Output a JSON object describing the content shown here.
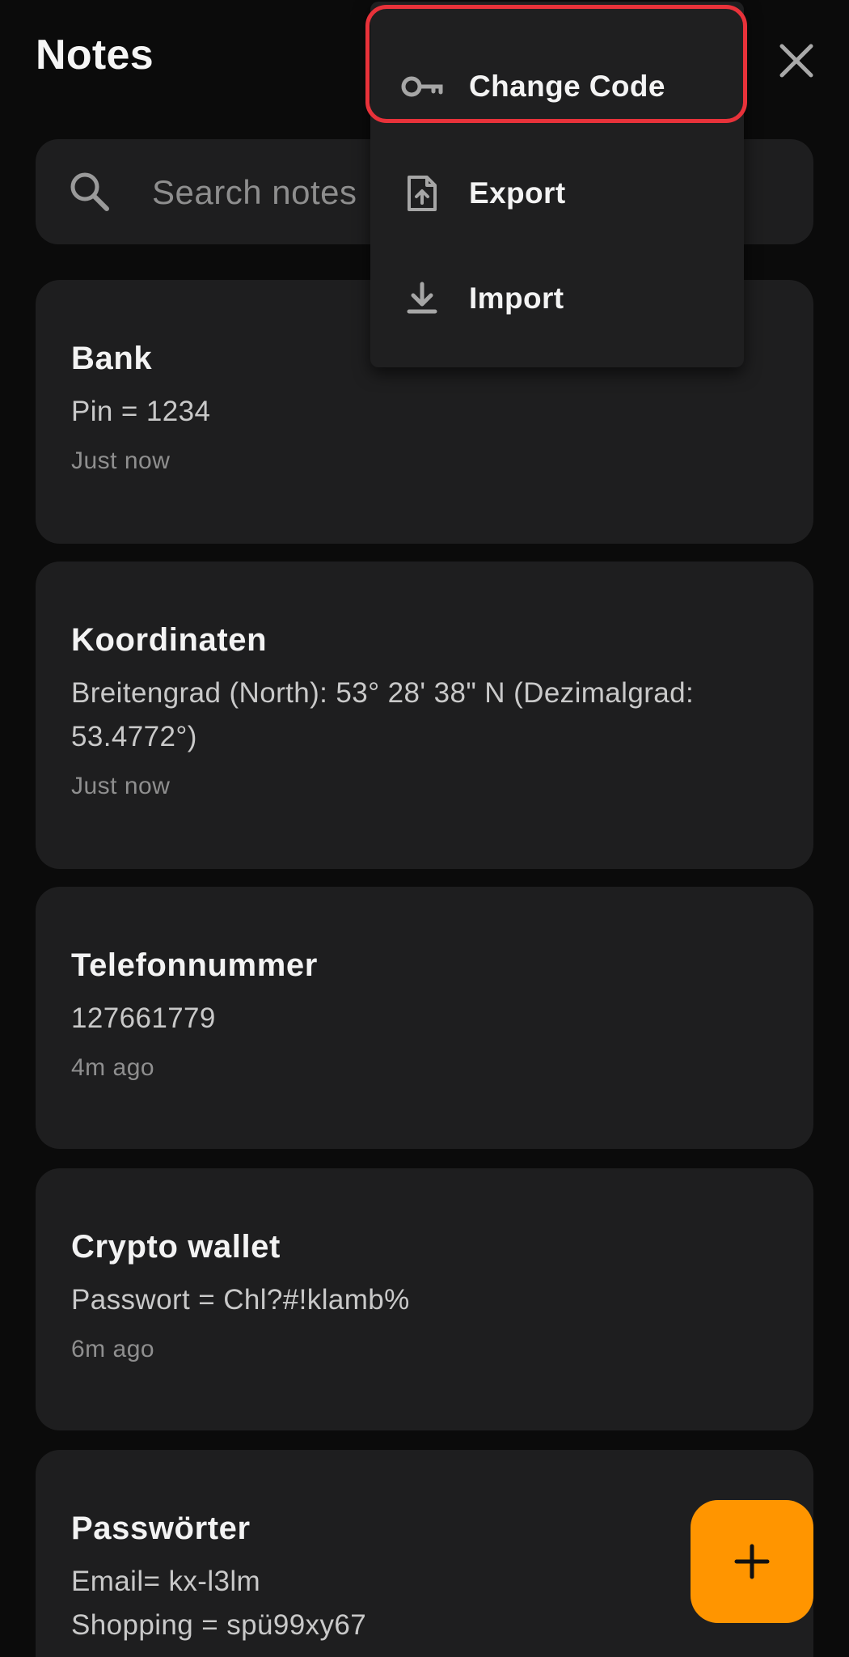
{
  "header": {
    "title": "Notes",
    "close_icon": "close-icon"
  },
  "search": {
    "placeholder": "Search notes",
    "icon": "search-icon"
  },
  "menu": {
    "items": [
      {
        "label": "Change Code",
        "icon": "key-icon"
      },
      {
        "label": "Export",
        "icon": "file-export-icon"
      },
      {
        "label": "Import",
        "icon": "download-icon"
      }
    ],
    "highlight_color": "#e8323a"
  },
  "notes": [
    {
      "title": "Bank",
      "body": "Pin = 1234",
      "time": "Just now"
    },
    {
      "title": "Koordinaten",
      "body": "Breitengrad (North): 53° 28' 38\" N (Dezimalgrad:\n53.4772°)",
      "time": "Just now"
    },
    {
      "title": "Telefonnummer",
      "body": "127661779",
      "time": "4m ago"
    },
    {
      "title": "Crypto wallet",
      "body": "Passwort = Chl?#!klamb%",
      "time": "6m ago"
    },
    {
      "title": "Passwörter",
      "body": "Email= kx-l3lm\nShopping = spü99xy67",
      "time": ""
    }
  ],
  "fab": {
    "icon": "plus-icon",
    "color": "#ff9500"
  },
  "colors": {
    "background": "#0b0b0b",
    "card": "#1e1e1f",
    "accent": "#ff9500"
  }
}
